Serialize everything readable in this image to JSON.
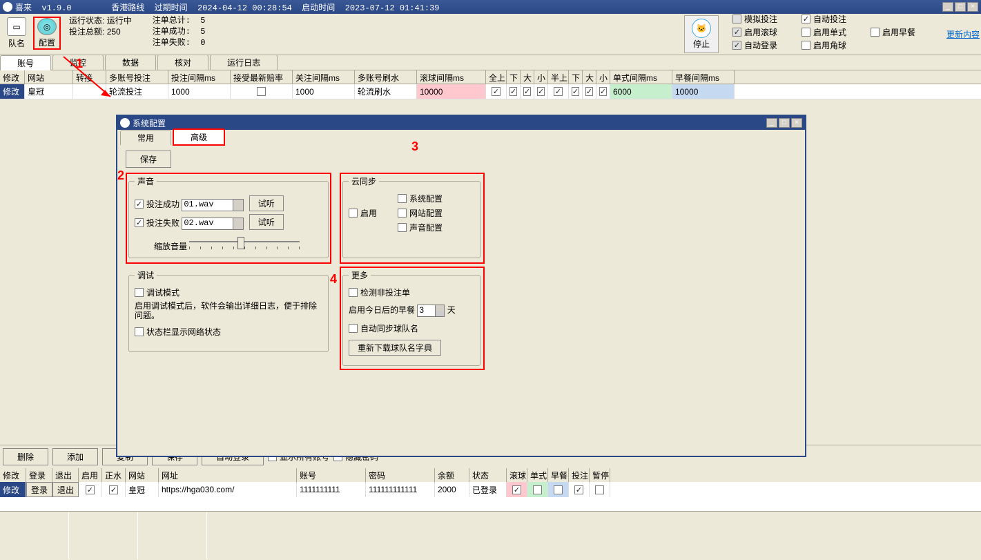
{
  "titlebar": {
    "title": "喜来  v1.9.0        香港路线  过期时间  2024-04-12 00:28:54  启动时间  2023-07-12 01:41:39"
  },
  "toolbar": {
    "team_label": "队名",
    "config_label": "配置",
    "run_status_label": "运行状态:",
    "run_status_value": "运行中",
    "bet_total_label": "投注总额:",
    "bet_total_value": "250",
    "stats": "注单总计:  5\n注单成功:  5\n注单失败:  0",
    "stop_label": "停止"
  },
  "checks": {
    "sim_bet": "模拟投注",
    "auto_bet": "自动投注",
    "enable_roll": "启用滚球",
    "enable_single": "启用单式",
    "enable_morning": "启用早餐",
    "auto_login": "自动登录",
    "enable_corner": "启用角球",
    "update_link": "更新内容"
  },
  "main_tabs": [
    "账号",
    "监控",
    "数据",
    "核对",
    "运行日志"
  ],
  "grid": {
    "headers": [
      "修改",
      "网站",
      "转接",
      "多账号投注",
      "投注间隔ms",
      "接受最新赔率",
      "关注间隔ms",
      "多账号刷水",
      "滚球间隔ms",
      "全上",
      "下",
      "大",
      "小",
      "半上",
      "下",
      "大",
      "小",
      "单式间隔ms",
      "早餐间隔ms"
    ],
    "row": {
      "modify": "修改",
      "site": "皇冠",
      "multi": "轮流投注",
      "interval": "1000",
      "watch": "1000",
      "shuashui": "轮流刷水",
      "roll": "10000",
      "single": "6000",
      "morning": "10000"
    }
  },
  "dialog": {
    "title": "系统配置",
    "tabs": {
      "normal": "常用",
      "advanced": "高级"
    },
    "save": "保存",
    "sound": {
      "legend": "声音",
      "success": "投注成功",
      "fail": "投注失败",
      "wav1": "01.wav",
      "wav2": "02.wav",
      "listen": "试听",
      "volume": "缩放音量"
    },
    "cloud": {
      "legend": "云同步",
      "enable": "启用",
      "sysconf": "系统配置",
      "siteconf": "网站配置",
      "soundconf": "声音配置"
    },
    "debug": {
      "legend": "调试",
      "mode": "调试模式",
      "desc": "启用调试模式后，软件会输出详细日志，便于排除问题。",
      "statusbar": "状态栏显示网络状态"
    },
    "more": {
      "legend": "更多",
      "detect": "检测非投注单",
      "morning_label": "启用今日后的早餐",
      "days_value": "3",
      "days_unit": "天",
      "sync_team": "自动同步球队名",
      "redownload": "重新下载球队名字典"
    }
  },
  "bottom": {
    "buttons": [
      "删除",
      "添加",
      "复制",
      "保存",
      "自动登录"
    ],
    "show_all": "显示所有账号",
    "hide_pwd": "隐藏密码"
  },
  "acc": {
    "headers": [
      "修改",
      "登录",
      "退出",
      "启用",
      "正水",
      "网站",
      "网址",
      "账号",
      "密码",
      "余额",
      "状态",
      "滚球",
      "单式",
      "早餐",
      "投注",
      "暂停"
    ],
    "row": {
      "modify": "修改",
      "login": "登录",
      "logout": "退出",
      "site": "皇冠",
      "url": "https://hga030.com/",
      "acc": "1111111111",
      "pwd": "111111111111",
      "bal": "2000",
      "status": "已登录"
    }
  },
  "annotations": {
    "n1": "1",
    "n2": "2",
    "n3": "3",
    "n4": "4"
  }
}
